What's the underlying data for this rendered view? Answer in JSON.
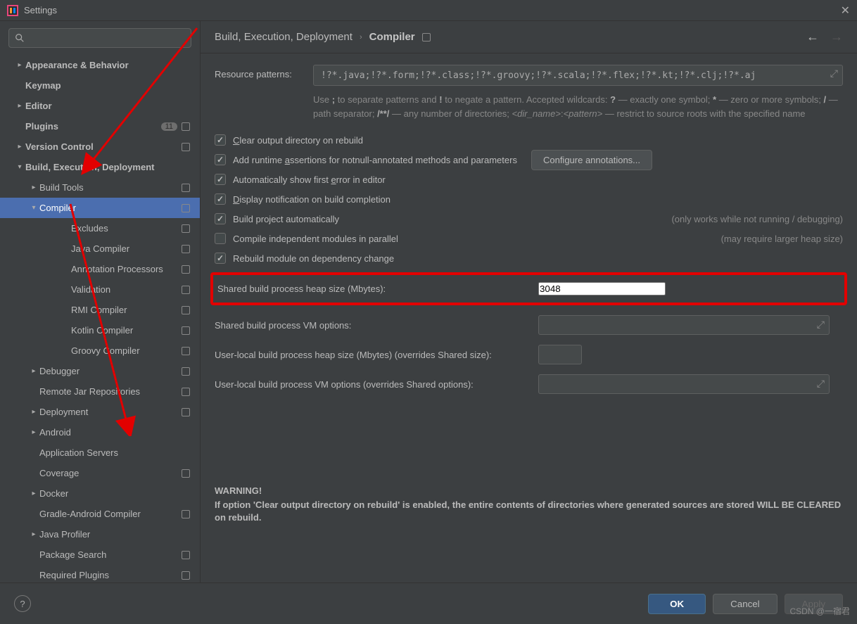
{
  "window": {
    "title": "Settings"
  },
  "search": {
    "placeholder": ""
  },
  "tree": [
    {
      "label": "Appearance & Behavior",
      "pad": 0,
      "arrow": "right",
      "bold": true
    },
    {
      "label": "Keymap",
      "pad": 0,
      "bold": true
    },
    {
      "label": "Editor",
      "pad": 0,
      "arrow": "right",
      "bold": true
    },
    {
      "label": "Plugins",
      "pad": 0,
      "bold": true,
      "badge": "11",
      "mod": true
    },
    {
      "label": "Version Control",
      "pad": 0,
      "arrow": "right",
      "bold": true,
      "mod": true
    },
    {
      "label": "Build, Execution, Deployment",
      "pad": 0,
      "arrow": "down",
      "bold": true
    },
    {
      "label": "Build Tools",
      "pad": 1,
      "arrow": "right",
      "mod": true
    },
    {
      "label": "Compiler",
      "pad": 1,
      "arrow": "down",
      "selected": true,
      "mod": true
    },
    {
      "label": "Excludes",
      "pad": 3,
      "mod": true
    },
    {
      "label": "Java Compiler",
      "pad": 3,
      "mod": true
    },
    {
      "label": "Annotation Processors",
      "pad": 3,
      "mod": true
    },
    {
      "label": "Validation",
      "pad": 3,
      "mod": true
    },
    {
      "label": "RMI Compiler",
      "pad": 3,
      "mod": true
    },
    {
      "label": "Kotlin Compiler",
      "pad": 3,
      "mod": true
    },
    {
      "label": "Groovy Compiler",
      "pad": 3,
      "mod": true
    },
    {
      "label": "Debugger",
      "pad": 1,
      "arrow": "right",
      "mod": true
    },
    {
      "label": "Remote Jar Repositories",
      "pad": 1,
      "mod": true
    },
    {
      "label": "Deployment",
      "pad": 1,
      "arrow": "right",
      "mod": true
    },
    {
      "label": "Android",
      "pad": 1,
      "arrow": "right"
    },
    {
      "label": "Application Servers",
      "pad": 1
    },
    {
      "label": "Coverage",
      "pad": 1,
      "mod": true
    },
    {
      "label": "Docker",
      "pad": 1,
      "arrow": "right"
    },
    {
      "label": "Gradle-Android Compiler",
      "pad": 1,
      "mod": true
    },
    {
      "label": "Java Profiler",
      "pad": 1,
      "arrow": "right"
    },
    {
      "label": "Package Search",
      "pad": 1,
      "mod": true
    },
    {
      "label": "Required Plugins",
      "pad": 1,
      "mod": true
    }
  ],
  "breadcrumb": {
    "parent": "Build, Execution, Deployment",
    "current": "Compiler"
  },
  "pattern": {
    "label": "Resource patterns:",
    "value": "!?*.java;!?*.form;!?*.class;!?*.groovy;!?*.scala;!?*.flex;!?*.kt;!?*.clj;!?*.aj",
    "help1": "Use ; to separate patterns and ! to negate a pattern. Accepted wildcards: ? — exactly one symbol; * — zero or more symbols; / — path separator; /**/ — any number of directories; <dir_name>:<pattern> — restrict to source roots with the specified name"
  },
  "checks": [
    {
      "label": "Clear output directory on rebuild",
      "checked": true
    },
    {
      "label": "Add runtime assertions for notnull-annotated methods and parameters",
      "checked": true,
      "button": "Configure annotations..."
    },
    {
      "label": "Automatically show first error in editor",
      "checked": true
    },
    {
      "label": "Display notification on build completion",
      "checked": true
    },
    {
      "label": "Build project automatically",
      "checked": true,
      "hint": "(only works while not running / debugging)"
    },
    {
      "label": "Compile independent modules in parallel",
      "checked": false,
      "hint": "(may require larger heap size)"
    },
    {
      "label": "Rebuild module on dependency change",
      "checked": true
    }
  ],
  "fields": {
    "heap": {
      "label": "Shared build process heap size (Mbytes):",
      "value": "3048"
    },
    "vm": {
      "label": "Shared build process VM options:"
    },
    "user_heap": {
      "label": "User-local build process heap size (Mbytes) (overrides Shared size):"
    },
    "user_vm": {
      "label": "User-local build process VM options (overrides Shared options):"
    }
  },
  "warning": {
    "head": "WARNING!",
    "body": "If option 'Clear output directory on rebuild' is enabled, the entire contents of directories where generated sources are stored WILL BE CLEARED on rebuild."
  },
  "footer": {
    "ok": "OK",
    "cancel": "Cancel",
    "apply": "Apply"
  },
  "watermark": "CSDN @一宿君"
}
